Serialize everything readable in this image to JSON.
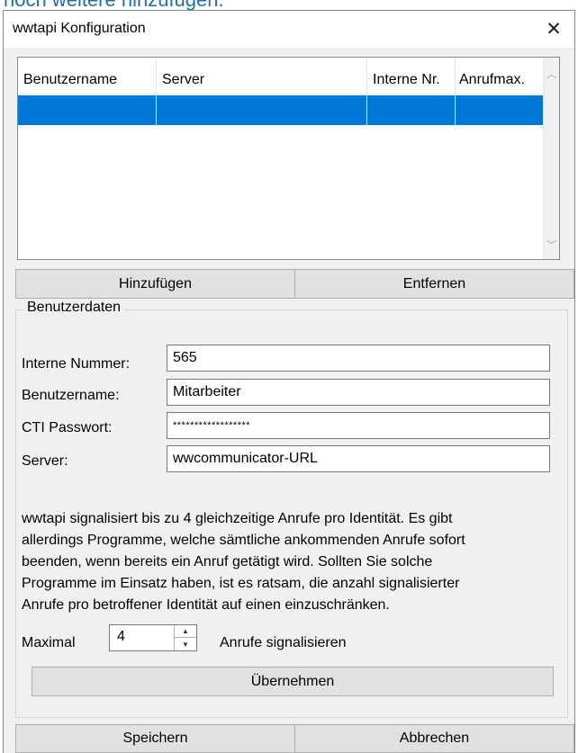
{
  "background": {
    "text": "noch weitere hinzufügen."
  },
  "window": {
    "title": "wwtapi Konfiguration",
    "close_glyph": "✕"
  },
  "list": {
    "columns": [
      "Benutzername",
      "Server",
      "Interne Nr.",
      "Anrufmax."
    ],
    "selected_row_color": "#0078d7"
  },
  "buttons": {
    "add": "Hinzufügen",
    "remove": "Entfernen",
    "apply": "Übernehmen",
    "save": "Speichern",
    "cancel": "Abbrechen"
  },
  "user_data": {
    "legend": "Benutzerdaten",
    "internal_number_label": "Interne Nummer:",
    "internal_number_value": "565",
    "username_label": "Benutzername:",
    "username_value": "Mitarbeiter",
    "password_label": "CTI Passwort:",
    "password_value": "******************",
    "server_label": "Server:",
    "server_value": "wwcommunicator-URL"
  },
  "info_text": {
    "line1": "wwtapi signalisiert bis zu 4 gleichzeitige Anrufe pro Identität. Es gibt",
    "line2": "allerdings Programme, welche sämtliche ankommenden Anrufe sofort",
    "line3": "beenden, wenn bereits ein Anruf getätigt wird. Sollten Sie solche",
    "line4": "Programme im Einsatz haben, ist es ratsam, die anzahl signalisierter",
    "line5": "Anrufe pro betroffener Identität auf einen einzuschränken."
  },
  "max_calls": {
    "prefix": "Maximal",
    "value": "4",
    "suffix": "Anrufe signalisieren"
  }
}
